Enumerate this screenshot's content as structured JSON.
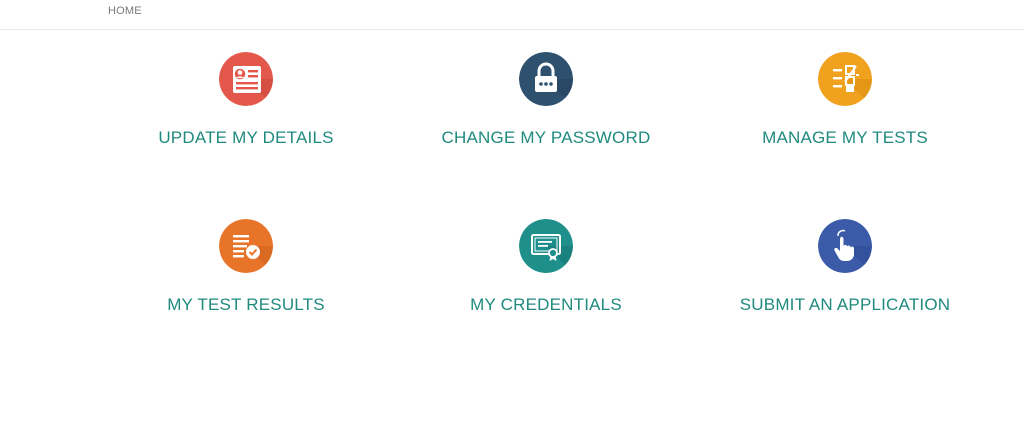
{
  "breadcrumb": {
    "home_label": "HOME"
  },
  "tiles": [
    {
      "label": "UPDATE MY DETAILS",
      "icon": "id-card-icon",
      "color": "#e3584b"
    },
    {
      "label": "CHANGE MY PASSWORD",
      "icon": "lock-icon",
      "color": "#2e5170"
    },
    {
      "label": "MANAGE MY TESTS",
      "icon": "checklist-icon",
      "color": "#f0a11e"
    },
    {
      "label": "MY TEST RESULTS",
      "icon": "results-document-icon",
      "color": "#e8742a"
    },
    {
      "label": "MY CREDENTIALS",
      "icon": "certificate-icon",
      "color": "#1f8f8c"
    },
    {
      "label": "SUBMIT AN APPLICATION",
      "icon": "hand-pointer-icon",
      "color": "#3b5ba8"
    }
  ]
}
